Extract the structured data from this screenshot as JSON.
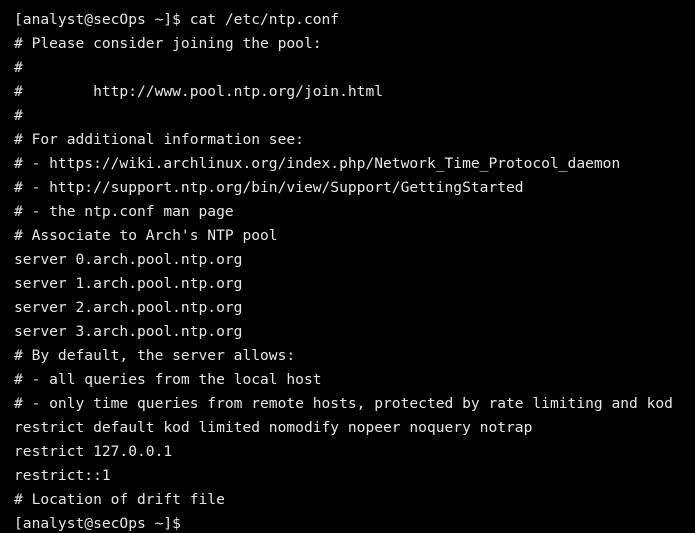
{
  "terminal": {
    "lines": [
      "[analyst@secOps ~]$ cat /etc/ntp.conf",
      "# Please consider joining the pool:",
      "#",
      "#        http://www.pool.ntp.org/join.html",
      "#",
      "# For additional information see:",
      "# - https://wiki.archlinux.org/index.php/Network_Time_Protocol_daemon",
      "# - http://support.ntp.org/bin/view/Support/GettingStarted",
      "# - the ntp.conf man page",
      "# Associate to Arch's NTP pool",
      "server 0.arch.pool.ntp.org",
      "server 1.arch.pool.ntp.org",
      "server 2.arch.pool.ntp.org",
      "server 3.arch.pool.ntp.org",
      "# By default, the server allows:",
      "# - all queries from the local host",
      "# - only time queries from remote hosts, protected by rate limiting and kod",
      "restrict default kod limited nomodify nopeer noquery notrap",
      "restrict 127.0.0.1",
      "restrict::1",
      "# Location of drift file"
    ],
    "prompt": "[analyst@secOps ~]$"
  }
}
